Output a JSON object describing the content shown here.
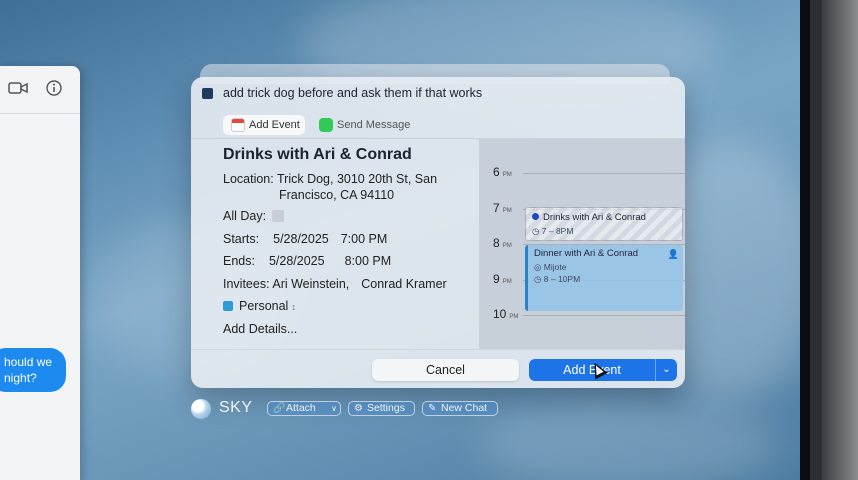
{
  "messages_window": {
    "bubble_lines": [
      "hould we",
      "night?"
    ]
  },
  "prompt": {
    "text": "add trick dog before and ask them if that works"
  },
  "tabs": [
    {
      "label": "Add Event",
      "icon": "calendar-icon",
      "active": true
    },
    {
      "label": "Send Message",
      "icon": "message-icon",
      "active": false
    }
  ],
  "event": {
    "title": "Drinks with Ari & Conrad",
    "location_label": "Location:",
    "location_line1": "Trick Dog, 3010 20th St, San",
    "location_line2": "Francisco, CA 94110",
    "all_day_label": "All Day:",
    "starts_label": "Starts:",
    "start_date": "5/28/2025",
    "start_time": "7:00 PM",
    "ends_label": "Ends:",
    "end_date": "5/28/2025",
    "end_time": "8:00 PM",
    "invitees_label": "Invitees:",
    "invitees": [
      "Ari Weinstein,",
      "Conrad Kramer"
    ],
    "calendar": "Personal",
    "calendar_color": "#2e9bd6",
    "add_details": "Add Details..."
  },
  "timeline": {
    "hours": [
      {
        "hour": "6",
        "suffix": "PM"
      },
      {
        "hour": "7",
        "suffix": "PM"
      },
      {
        "hour": "8",
        "suffix": "PM"
      },
      {
        "hour": "9",
        "suffix": "PM"
      },
      {
        "hour": "10",
        "suffix": "PM"
      }
    ],
    "new_event": {
      "title": "Drinks with Ari & Conrad",
      "time": "7 – 8PM"
    },
    "existing_event": {
      "title": "Dinner with Ari & Conrad",
      "place": "Mijote",
      "time": "8 – 10PM"
    }
  },
  "footer": {
    "cancel_label": "Cancel",
    "add_label": "Add Event"
  },
  "skybar": {
    "name": "SKY",
    "attach_label": "Attach",
    "settings_label": "Settings",
    "new_chat_label": "New Chat"
  },
  "colors": {
    "accent": "#1d74e8",
    "imessage_blue": "#1d8af0"
  }
}
